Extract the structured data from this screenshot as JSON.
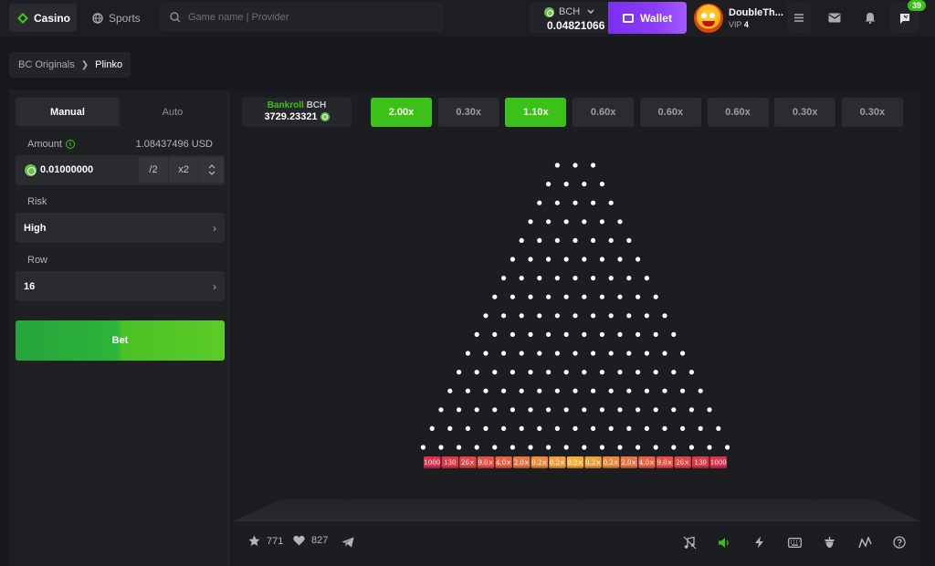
{
  "header": {
    "nav": [
      {
        "label": "Casino",
        "active": true
      },
      {
        "label": "Sports",
        "active": false
      }
    ],
    "search_placeholder": "Game name | Provider",
    "balance": {
      "currency": "BCH",
      "amount": "0.04821066"
    },
    "wallet_label": "Wallet",
    "user": {
      "name": "DoubleTh...",
      "vip_prefix": "VIP",
      "vip_level": "4"
    },
    "notifications_count": "39"
  },
  "breadcrumb": {
    "parent": "BC Originals",
    "current": "Plinko"
  },
  "bet_panel": {
    "tabs": [
      "Manual",
      "Auto"
    ],
    "amount_label": "Amount",
    "amount_usd": "1.08437496 USD",
    "amount_value": "0.01000000",
    "half_label": "/2",
    "double_label": "x2",
    "risk_label": "Risk",
    "risk_value": "High",
    "row_label": "Row",
    "row_value": "16",
    "bet_label": "Bet"
  },
  "game": {
    "bankroll_label": "Bankroll",
    "bankroll_currency": "BCH",
    "bankroll_value": "3729.23321",
    "history": [
      {
        "value": "2.00x",
        "win": true
      },
      {
        "value": "0.30x",
        "win": false
      },
      {
        "value": "1.10x",
        "win": true
      },
      {
        "value": "0.60x",
        "win": false
      },
      {
        "value": "0.60x",
        "win": false
      },
      {
        "value": "0.60x",
        "win": false
      },
      {
        "value": "0.30x",
        "win": false
      },
      {
        "value": "0.30x",
        "win": false
      }
    ],
    "rows": 16,
    "multipliers": [
      "1000",
      "130",
      "26×",
      "9.0×",
      "4.0×",
      "2.0×",
      "0.2×",
      "0.2×",
      "0.2×",
      "0.2×",
      "0.2×",
      "2.0×",
      "4.0×",
      "9.0×",
      "26×",
      "130",
      "1000"
    ],
    "multiplier_colors": [
      "#e0314b",
      "#e2384a",
      "#e34448",
      "#e65246",
      "#e86243",
      "#ec7641",
      "#ef8a3e",
      "#f29e3c",
      "#f4ae3a",
      "#f29e3c",
      "#ef8a3e",
      "#ec7641",
      "#e86243",
      "#e65246",
      "#e34448",
      "#e2384a",
      "#e0314b"
    ]
  },
  "footer": {
    "favorites": "771",
    "likes": "827"
  },
  "colors": {
    "accent_green": "#3bc117",
    "wallet_purple": "#7b2ff0"
  }
}
